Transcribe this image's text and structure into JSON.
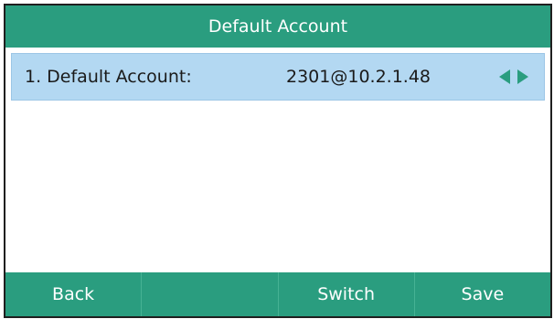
{
  "header": {
    "title": "Default Account"
  },
  "list": {
    "items": [
      {
        "label": "1. Default Account:",
        "value": "2301@10.2.1.48",
        "left_icon": "left-arrow-icon",
        "right_icon": "right-arrow-icon"
      }
    ]
  },
  "softkeys": {
    "back_label": "Back",
    "empty_label": "",
    "switch_label": "Switch",
    "save_label": "Save"
  },
  "colors": {
    "accent": "#2a9d7f",
    "selection": "#b3d8f2",
    "arrow": "#2a9d7f"
  }
}
